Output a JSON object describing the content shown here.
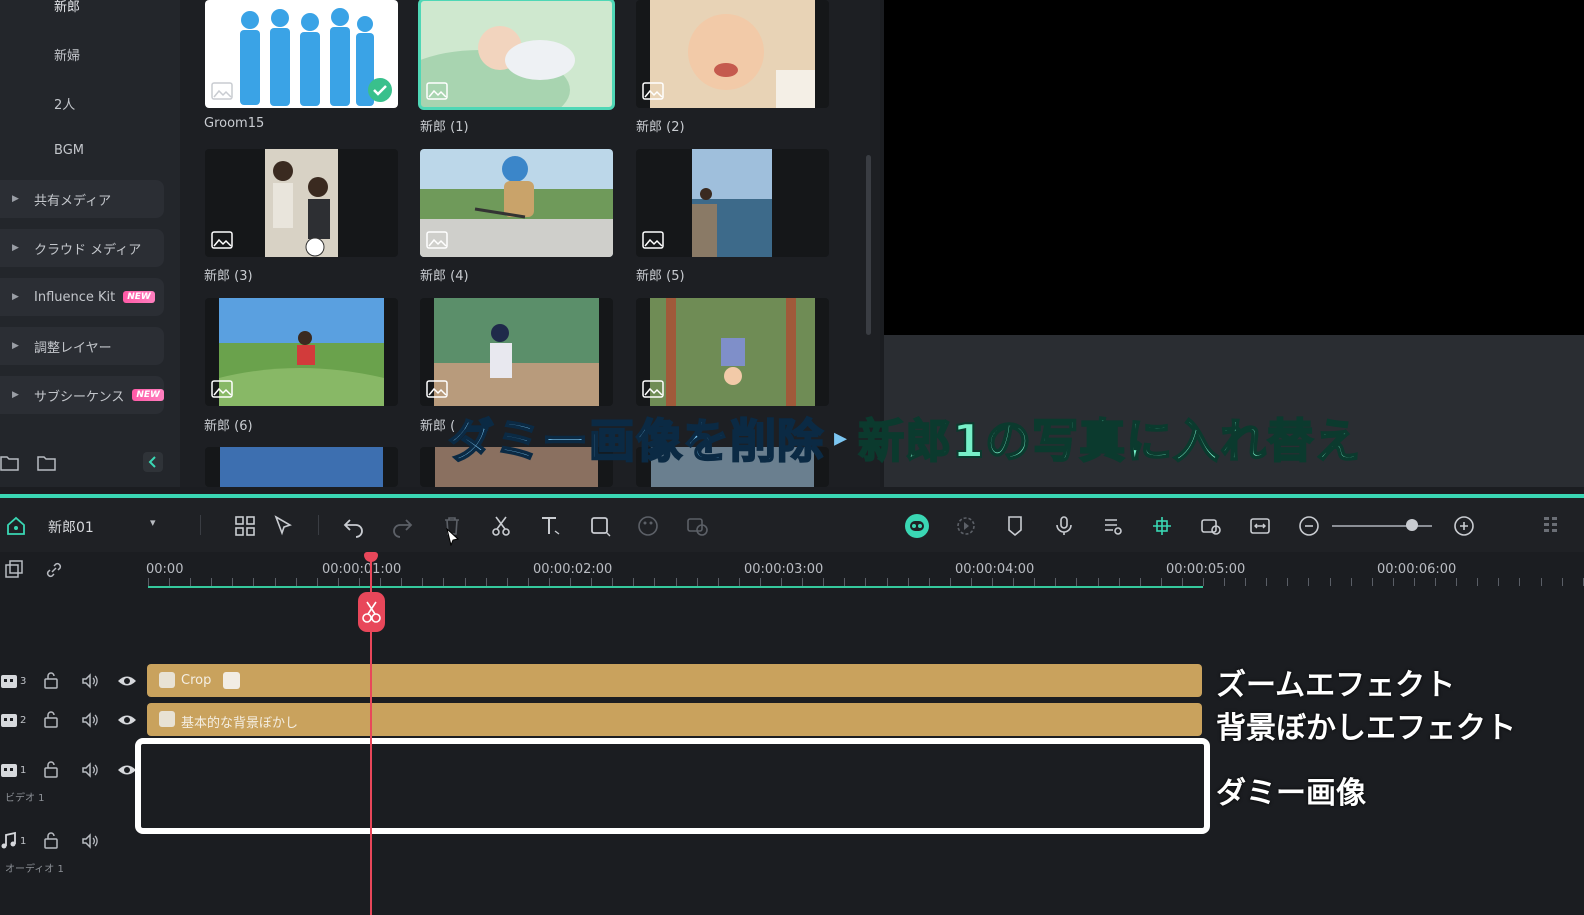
{
  "sidebar": {
    "sub_items": [
      "新郎",
      "新婦",
      "2人",
      "BGM"
    ],
    "folders": [
      {
        "label": "共有メディア",
        "badge": ""
      },
      {
        "label": "クラウド メディア",
        "badge": ""
      },
      {
        "label": "Influence Kit",
        "badge": "NEW"
      },
      {
        "label": "調整レイヤー",
        "badge": ""
      },
      {
        "label": "サブシーケンス",
        "badge": "NEW"
      }
    ]
  },
  "media": {
    "items": [
      {
        "label": "Groom15",
        "selected": false,
        "checked": true
      },
      {
        "label": "新郎 (1)",
        "selected": true,
        "checked": false
      },
      {
        "label": "新郎 (2)",
        "selected": false,
        "checked": false
      },
      {
        "label": "新郎 (3)",
        "selected": false,
        "checked": false
      },
      {
        "label": "新郎 (4)",
        "selected": false,
        "checked": false
      },
      {
        "label": "新郎 (5)",
        "selected": false,
        "checked": false
      },
      {
        "label": "新郎 (6)",
        "selected": false,
        "checked": false
      },
      {
        "label": "新郎 (",
        "selected": false,
        "checked": false
      }
    ]
  },
  "caption": {
    "part1": "ダミー画像を削除",
    "arrow": "▸",
    "part2": "新郎1の写真に入れ替え"
  },
  "toolbar": {
    "project_name": "新郎01",
    "project_dropdown": "▾"
  },
  "timeline": {
    "ruler_labels": [
      "00:00",
      "00:00:01:00",
      "00:00:02:00",
      "00:00:03:00",
      "00:00:04:00",
      "00:00:05:00",
      "00:00:06:00"
    ],
    "tracks": [
      {
        "number": "3",
        "name": "",
        "clip_label": "Crop"
      },
      {
        "number": "2",
        "name": "",
        "clip_label": "基本的な背景ぼかし"
      },
      {
        "number": "1",
        "name": "ビデオ 1",
        "clip_label": ""
      },
      {
        "number": "1",
        "name": "オーディオ 1",
        "clip_label": ""
      }
    ]
  },
  "annotations": {
    "track3": "ズームエフェクト",
    "track2": "背景ぼかしエフェクト",
    "track1": "ダミー画像"
  },
  "colors": {
    "accent": "#3ad7b4",
    "clip": "#c9a25d",
    "playhead": "#e8475a",
    "badge_new": "#ff5aa6"
  }
}
